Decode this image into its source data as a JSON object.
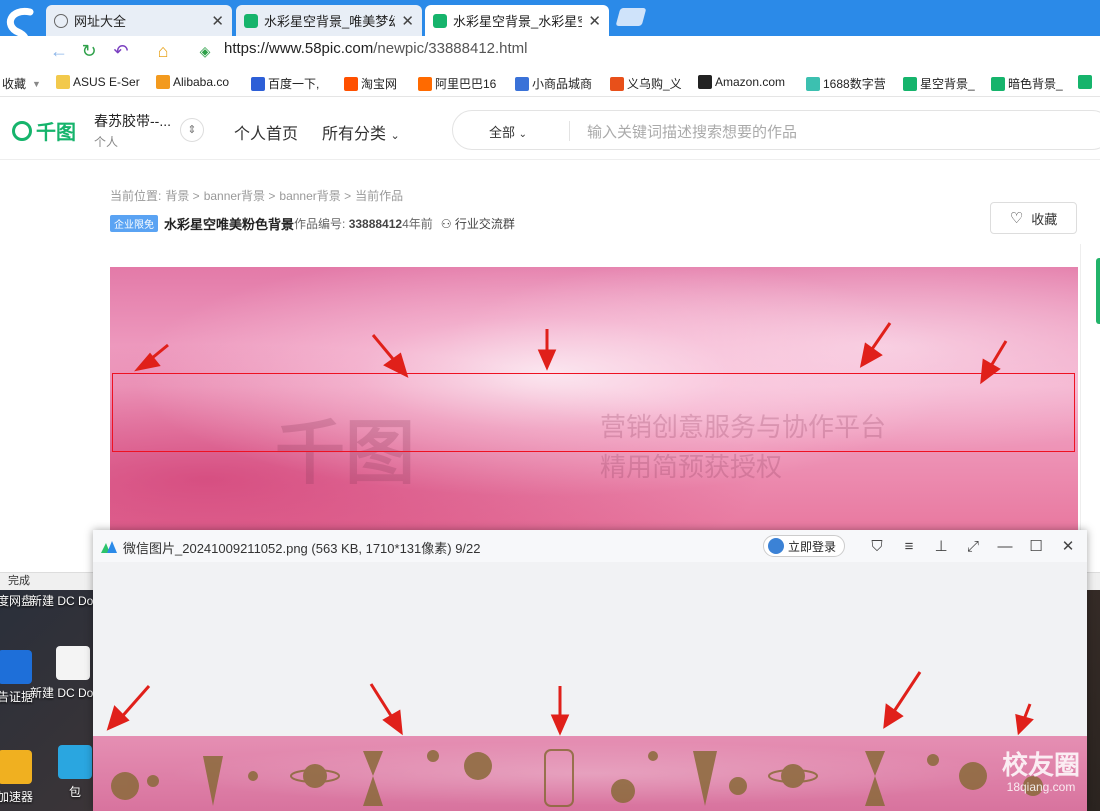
{
  "browser": {
    "tabs": [
      {
        "title": "网址大全",
        "active": false
      },
      {
        "title": "水彩星空背景_唯美梦幻",
        "active": false
      },
      {
        "title": "水彩星空背景_水彩星空",
        "active": true
      }
    ],
    "url_host": "https://www.58pic.com",
    "url_path": "/newpic/33888412.html",
    "bookmarks": [
      "收藏",
      "ASUS E-Ser",
      "Alibaba.co",
      "百度一下,",
      "淘宝网",
      "阿里巴巴16",
      "小商品城商",
      "义乌购_义",
      "Amazon.com",
      "1688数字营",
      "星空背景_",
      "暗色背景_"
    ],
    "status": "完成"
  },
  "site": {
    "logo": "千图",
    "user_name": "春苏胶带--...",
    "user_type": "个人",
    "nav": [
      "个人首页",
      "所有分类"
    ],
    "search_category": "全部",
    "search_placeholder": "输入关键词描述搜索想要的作品"
  },
  "work": {
    "breadcrumb": [
      "当前位置:",
      "背景 >",
      "banner背景 >",
      "banner背景 >",
      "当前作品"
    ],
    "badge": "企业限免",
    "title": "水彩星空唯美粉色背景",
    "no_label": "作品编号: ",
    "no_value": "33888412",
    "time": "4年前",
    "group": "行业交流群",
    "fav_label": "收藏",
    "watermark_logo": "千图",
    "watermark_line1": "营销创意服务与协作平台",
    "watermark_line2": "精用简预获授权"
  },
  "viewer": {
    "filename": "微信图片_20241009211052.png (563 KB, 1710*131像素) 9/22",
    "login": "立即登录"
  },
  "desktop": {
    "icons": [
      "度网盘",
      "新建 DC Docum",
      "告证据",
      "新建 DC Docum",
      "加速器",
      "包"
    ],
    "watermark": "校友圈",
    "watermark_url": "18qiang.com"
  },
  "colors": {
    "brand_green": "#16b46c",
    "tab_blue": "#2b8ae8",
    "highlight_red": "#e12",
    "arrow_red": "#e0201a"
  }
}
